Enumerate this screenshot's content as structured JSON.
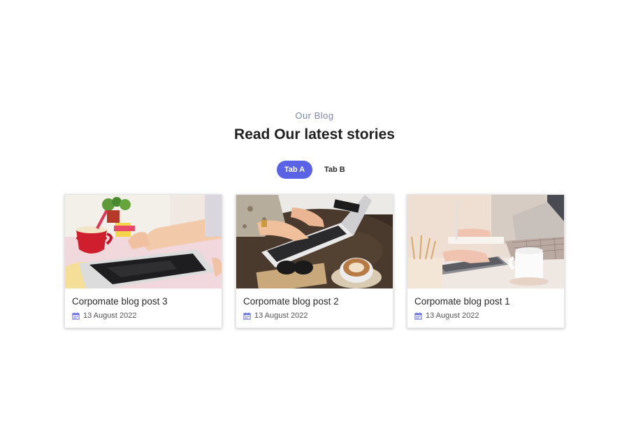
{
  "blog": {
    "eyebrow": "Our Blog",
    "heading": "Read Our latest stories"
  },
  "tabs": [
    {
      "label": "Tab A",
      "active": true
    },
    {
      "label": "Tab B",
      "active": false
    }
  ],
  "posts": [
    {
      "title": "Corpomate blog post 3",
      "date": "13 August 2022",
      "image": "tablet-and-red-cup-photo"
    },
    {
      "title": "Corpomate blog post 2",
      "date": "13 August 2022",
      "image": "laptop-and-coffee-photo"
    },
    {
      "title": "Corpomate blog post 1",
      "date": "13 August 2022",
      "image": "laptop-and-white-mug-photo"
    }
  ],
  "colors": {
    "accent": "#5a63e6",
    "eyebrow": "#7a86a6",
    "calendar_icon": "#6b73e0"
  }
}
